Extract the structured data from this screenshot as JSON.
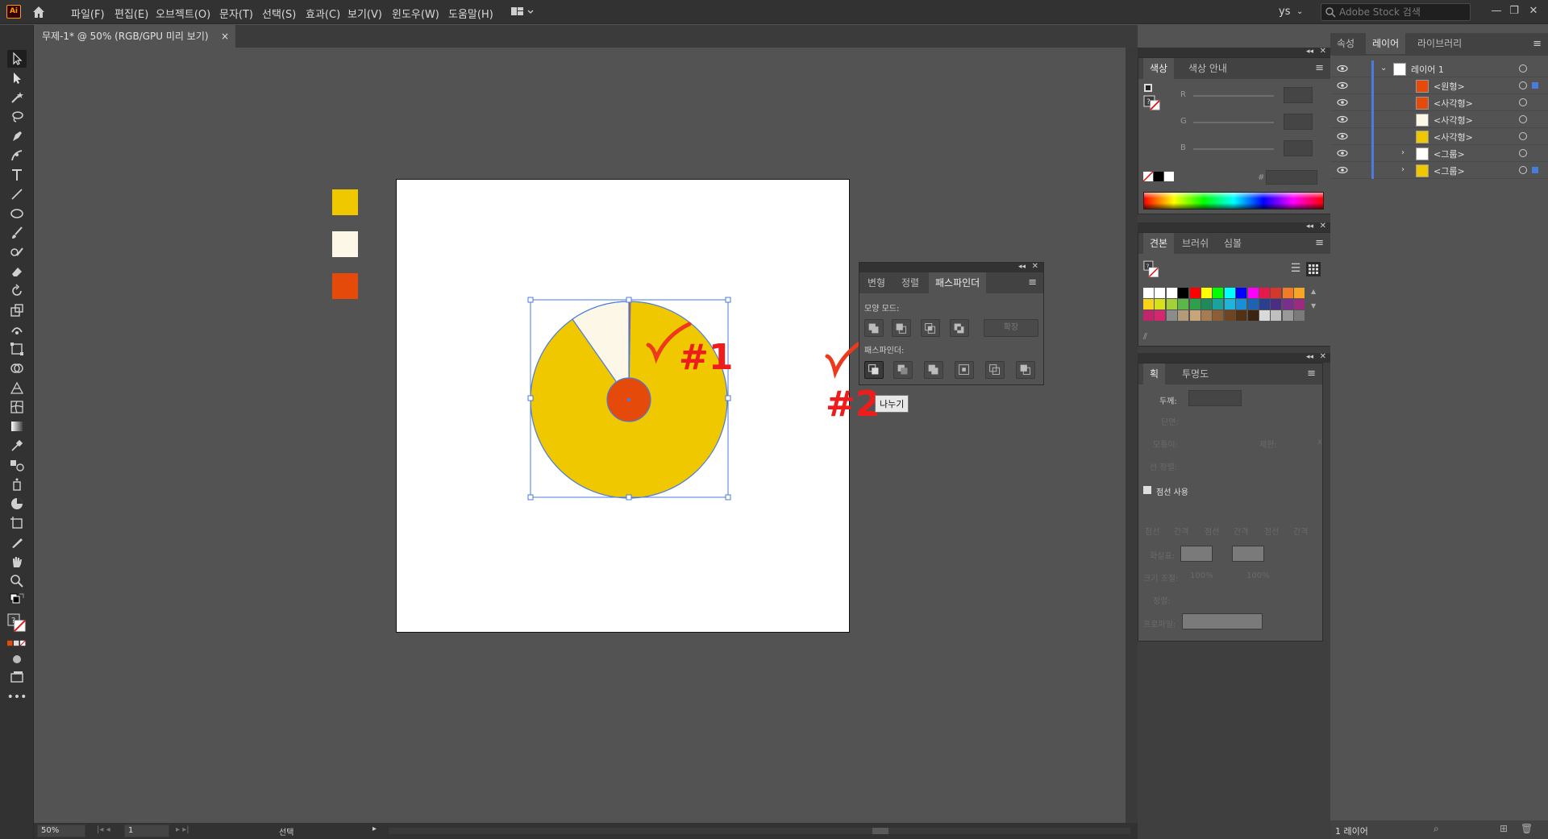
{
  "app": {
    "logo": "Ai",
    "menu": [
      "파일(F)",
      "편집(E)",
      "오브젝트(O)",
      "문자(T)",
      "선택(S)",
      "효과(C)",
      "보기(V)",
      "윈도우(W)",
      "도움말(H)"
    ],
    "user": "ys",
    "search_placeholder": "Adobe Stock 검색"
  },
  "document": {
    "tab_title": "무제-1* @ 50% (RGB/GPU 미리 보기)",
    "close": "×"
  },
  "color_panel": {
    "tabs": [
      "색상",
      "색상 안내"
    ],
    "channels": [
      "R",
      "G",
      "B"
    ],
    "hash": "#"
  },
  "pathfinder_panel": {
    "tabs": [
      "변형",
      "정렬",
      "패스파인더"
    ],
    "shape_modes_label": "모양 모드:",
    "expand_label": "확장",
    "pathfinders_label": "패스파인더:",
    "tooltip": "나누기"
  },
  "swatches_panel": {
    "tabs": [
      "견본",
      "브러쉬",
      "심볼"
    ]
  },
  "stroke_panel": {
    "tabs": [
      "획",
      "투명도"
    ],
    "weight_label": "두께:",
    "cap_label": "단면:",
    "corner_label": "모퉁이:",
    "limit_label": "제한:",
    "align_label": "선 정렬:",
    "dashed_label": "점선 사용",
    "dash_labels": [
      "점선",
      "간격",
      "점선",
      "간격",
      "점선",
      "간격"
    ],
    "arrow_label": "화살표:",
    "scale_label": "크기 조절:",
    "scale_values": [
      "100%",
      "100%"
    ],
    "align2_label": "정렬:",
    "profile_label": "프로파일:",
    "limit_x": "x"
  },
  "right_tabs": [
    "속성",
    "레이어",
    "라이브러리"
  ],
  "layers": {
    "rows": [
      {
        "name": "레이어 1",
        "color": "#ffffff"
      },
      {
        "name": "<원형>",
        "color": "#e64a0a"
      },
      {
        "name": "<사각형>",
        "color": "#e64a0a"
      },
      {
        "name": "<사각형>",
        "color": "#fdf7e7"
      },
      {
        "name": "<사각형>",
        "color": "#f0c800"
      },
      {
        "name": "<그룹>",
        "color": "#ffffff"
      },
      {
        "name": "<그룹>",
        "color": "#f0c800"
      }
    ],
    "footer": "1 레이어"
  },
  "status_bar": {
    "zoom": "50%",
    "page": "1",
    "mode": "선택"
  },
  "annotations": {
    "first": "#1",
    "second": "#2"
  },
  "colors": {
    "yellow": "#f0c800",
    "cream": "#fdf7e7",
    "orange_red": "#e64a0a",
    "selection": "#4a7bde"
  }
}
